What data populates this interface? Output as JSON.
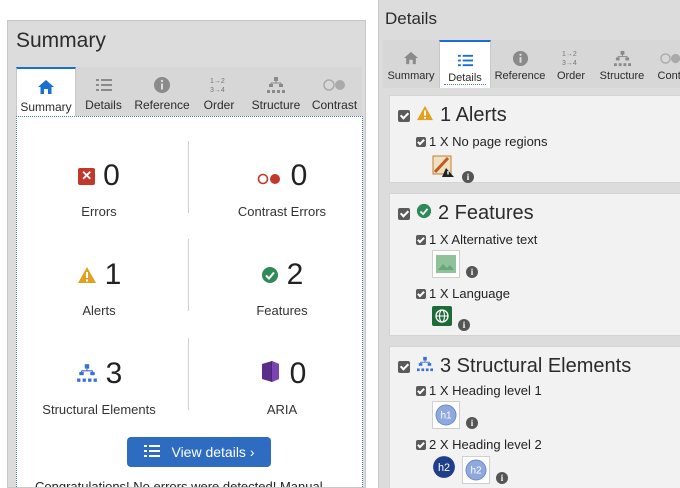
{
  "summary_panel": {
    "title": "Summary",
    "tabs": [
      {
        "label": "Summary",
        "icon": "home-icon"
      },
      {
        "label": "Details",
        "icon": "list-icon"
      },
      {
        "label": "Reference",
        "icon": "info-icon"
      },
      {
        "label": "Order",
        "icon": "order-icon"
      },
      {
        "label": "Structure",
        "icon": "hierarchy-icon"
      },
      {
        "label": "Contrast",
        "icon": "contrast-icon"
      }
    ],
    "active_tab": "Summary",
    "stats": [
      {
        "count": "0",
        "label": "Errors",
        "icon": "error-icon"
      },
      {
        "count": "0",
        "label": "Contrast Errors",
        "icon": "contrast-icon"
      },
      {
        "count": "1",
        "label": "Alerts",
        "icon": "alert-icon"
      },
      {
        "count": "2",
        "label": "Features",
        "icon": "check-icon"
      },
      {
        "count": "3",
        "label": "Structural Elements",
        "icon": "hierarchy-icon"
      },
      {
        "count": "0",
        "label": "ARIA",
        "icon": "aria-cube-icon"
      }
    ],
    "view_details_label": "View details ›",
    "congrats_text": "Congratulations! No errors were detected! Manual"
  },
  "details_panel": {
    "title": "Details",
    "tabs": [
      {
        "label": "Summary",
        "icon": "home-icon"
      },
      {
        "label": "Details",
        "icon": "list-icon"
      },
      {
        "label": "Reference",
        "icon": "info-icon"
      },
      {
        "label": "Order",
        "icon": "order-icon"
      },
      {
        "label": "Structure",
        "icon": "hierarchy-icon"
      },
      {
        "label": "Contr",
        "icon": "contrast-icon"
      }
    ],
    "active_tab": "Details",
    "sections": [
      {
        "heading": "1 Alerts",
        "icon": "alert-icon",
        "items": [
          {
            "label": "1 X No page regions",
            "icons": [
              "no-regions-icon"
            ]
          }
        ]
      },
      {
        "heading": "2 Features",
        "icon": "check-icon",
        "items": [
          {
            "label": "1 X Alternative text",
            "icons": [
              "alt-text-icon"
            ]
          },
          {
            "label": "1 X Language",
            "icons": [
              "language-icon"
            ]
          }
        ]
      },
      {
        "heading": "3 Structural Elements",
        "icon": "hierarchy-icon",
        "items": [
          {
            "label": "1 X Heading level 1",
            "icons": [
              "h1-icon"
            ],
            "badges": [
              "h1"
            ]
          },
          {
            "label": "2 X Heading level 2",
            "icons": [
              "h2-icon",
              "h2-icon"
            ],
            "badges": [
              "h2",
              "h2"
            ]
          }
        ]
      }
    ]
  },
  "colors": {
    "accent": "#1a6fd4",
    "button": "#2d6cc0",
    "error": "#c0392b",
    "alert": "#e0a020",
    "feature": "#2e8b57",
    "structure": "#3b6fd0",
    "aria": "#5b2d8a"
  }
}
